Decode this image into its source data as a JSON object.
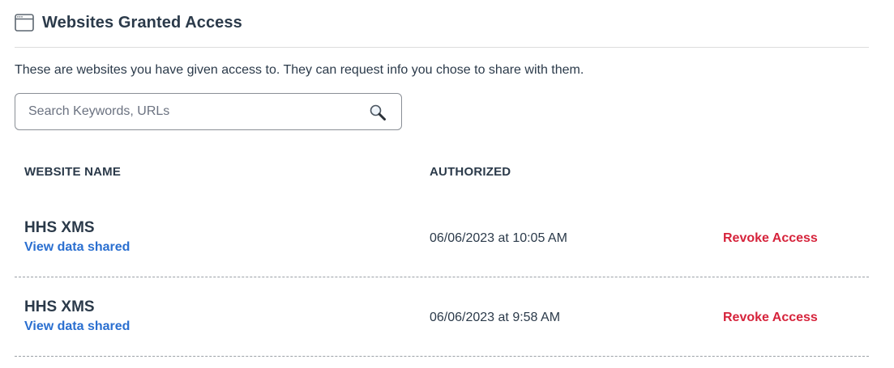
{
  "header": {
    "title": "Websites Granted Access",
    "icon": "browser-window-icon"
  },
  "description": "These are websites you have given access to. They can request info you chose to share with them.",
  "search": {
    "placeholder": "Search Keywords, URLs",
    "value": "",
    "icon": "search-icon"
  },
  "table": {
    "columns": [
      "WEBSITE NAME",
      "AUTHORIZED"
    ],
    "rows": [
      {
        "name": "HHS XMS",
        "link": "View data shared",
        "authorized": "06/06/2023 at 10:05 AM",
        "action": "Revoke Access"
      },
      {
        "name": "HHS XMS",
        "link": "View data shared",
        "authorized": "06/06/2023 at 9:58 AM",
        "action": "Revoke Access"
      }
    ]
  },
  "colors": {
    "text": "#2b3a4a",
    "link": "#2a6fd0",
    "danger": "#d6243c"
  }
}
